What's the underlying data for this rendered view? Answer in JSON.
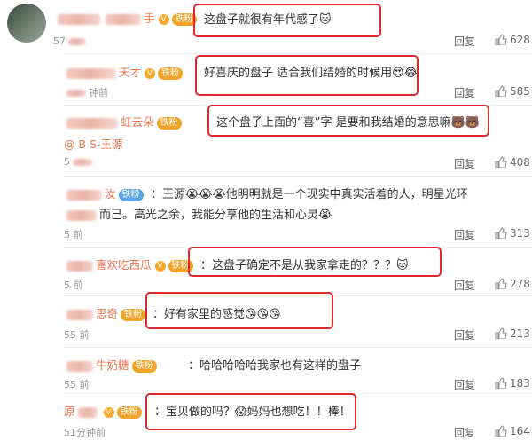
{
  "comments": [
    {
      "user": "手",
      "text": "这盘子就很有年代感了",
      "ts": "57",
      "reply": "回复",
      "likes": "628",
      "badge": "铁粉",
      "emojis": [
        "🐱"
      ]
    },
    {
      "user": "天才",
      "text": "好喜庆的盘子 适合我们结婚的时候用",
      "ts": "钟前",
      "reply": "回复",
      "likes": "585",
      "badge": "铁粉",
      "emojis": [
        "😍",
        "😂"
      ]
    },
    {
      "user": "虹云朵",
      "text": "这个盘子上面的“喜”字 是要和我结婚的意思嘛",
      "mention": "@ B S-王源",
      "ts": "5",
      "reply": "回复",
      "likes": "408",
      "badge": "铁粉",
      "emojis": [
        "🐻",
        "🐻"
      ]
    },
    {
      "user": "汝",
      "text": "王源",
      "text2": "他明明就是一个现实中真实活着的人，明星光环",
      "line2": "而已。高光之余，我能分享他的生活和心灵",
      "ts": "5 前",
      "reply": "回复",
      "likes": "313",
      "badge": "铁粉",
      "emojis": [
        "😭"
      ]
    },
    {
      "user": "喜欢吃西瓜",
      "text": "这盘子确定不是从我家拿走的？？？",
      "ts": "5 前",
      "reply": "回复",
      "likes": "278",
      "badge": "铁粉",
      "emojis": [
        "🐱"
      ]
    },
    {
      "user": "思奇",
      "text": "好有家里的感觉",
      "ts": "55 前",
      "reply": "回复",
      "likes": "213",
      "badge": "铁粉",
      "emojis": [
        "😘",
        "😘",
        "😘"
      ]
    },
    {
      "user": "牛奶糖",
      "text": "哈哈哈哈哈我家也有这样的盘子",
      "ts": "55 前",
      "reply": "回复",
      "likes": "183",
      "badge": "铁粉"
    },
    {
      "user": "原",
      "text": "宝贝做的吗？",
      "text2": "妈妈也想吃！！棒！",
      "ts": "51分钟前",
      "reply": "回复",
      "likes": "164",
      "badge": "铁粉",
      "emojis": [
        "😱"
      ]
    }
  ]
}
